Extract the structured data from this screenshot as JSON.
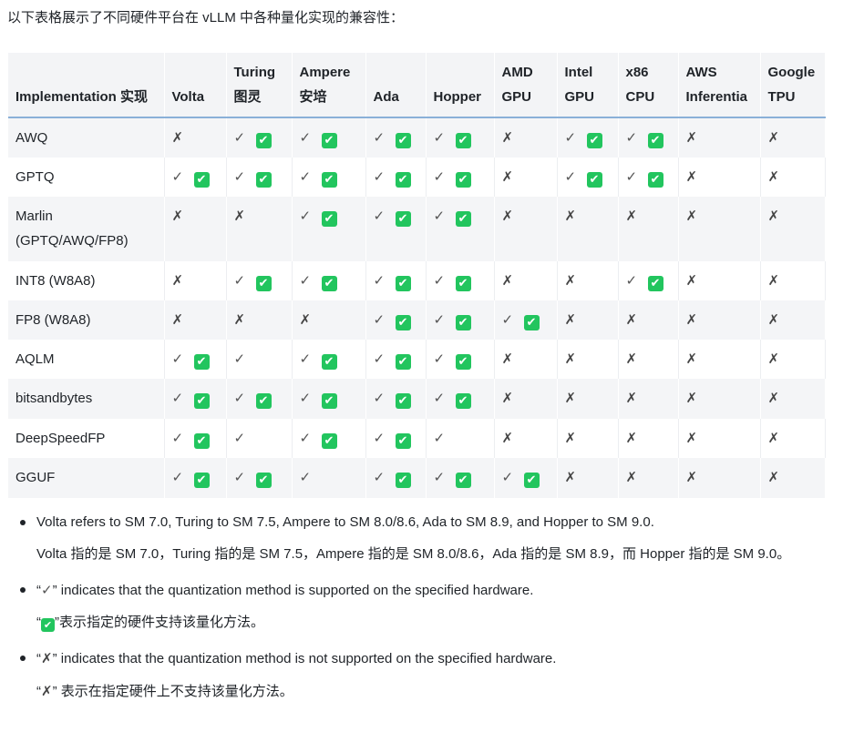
{
  "intro": "以下表格展示了不同硬件平台在 vLLM 中各种量化实现的兼容性：",
  "table": {
    "headers": [
      "Implementation 实现",
      "Volta",
      "Turing 图灵",
      "Ampere 安培",
      "Ada",
      "Hopper",
      "AMD GPU",
      "Intel GPU",
      "x86 CPU",
      "AWS Inferentia",
      "Google TPU"
    ],
    "rows": [
      {
        "name": "AWQ",
        "cells": [
          "x",
          "y",
          "y",
          "y",
          "y",
          "x",
          "y",
          "y",
          "x",
          "x"
        ]
      },
      {
        "name": "GPTQ",
        "cells": [
          "y",
          "y",
          "y",
          "y",
          "y",
          "x",
          "y",
          "y",
          "x",
          "x"
        ]
      },
      {
        "name": "Marlin (GPTQ/AWQ/FP8)",
        "cells": [
          "x",
          "x",
          "y",
          "y",
          "y",
          "x",
          "x",
          "x",
          "x",
          "x"
        ]
      },
      {
        "name": "INT8 (W8A8)",
        "cells": [
          "x",
          "y",
          "y",
          "y",
          "y",
          "x",
          "x",
          "y",
          "x",
          "x"
        ]
      },
      {
        "name": "FP8 (W8A8)",
        "cells": [
          "x",
          "x",
          "x",
          "y",
          "y",
          "y",
          "x",
          "x",
          "x",
          "x"
        ]
      },
      {
        "name": "AQLM",
        "cells": [
          "y",
          "c",
          "y",
          "y",
          "y",
          "x",
          "x",
          "x",
          "x",
          "x"
        ]
      },
      {
        "name": "bitsandbytes",
        "cells": [
          "y",
          "y",
          "y",
          "y",
          "y",
          "x",
          "x",
          "x",
          "x",
          "x"
        ]
      },
      {
        "name": "DeepSpeedFP",
        "cells": [
          "y",
          "c",
          "y",
          "y",
          "c",
          "x",
          "x",
          "x",
          "x",
          "x"
        ]
      },
      {
        "name": "GGUF",
        "cells": [
          "y",
          "y",
          "c",
          "y",
          "y",
          "y",
          "x",
          "x",
          "x",
          "x"
        ]
      }
    ]
  },
  "symbols": {
    "check": "✓",
    "box": "✔",
    "cross": "✗"
  },
  "notes": [
    {
      "en": "Volta refers to SM 7.0, Turing to SM 7.5, Ampere to SM 8.0/8.6, Ada to SM 8.9, and Hopper to SM 9.0.",
      "zh": "Volta 指的是 SM 7.0，Turing 指的是 SM 7.5，Ampere 指的是 SM 8.0/8.6，Ada 指的是 SM 8.9，而 Hopper 指的是 SM 9.0。"
    },
    {
      "en_prefix": "“",
      "en_suffix": "” indicates that the quantization method is supported on the specified hardware.",
      "zh_prefix": "“",
      "zh_suffix": "”表示指定的硬件支持该量化方法。"
    },
    {
      "en_prefix": "“",
      "en_suffix": "” indicates that the quantization method is not supported on the specified hardware.",
      "zh_prefix": "“",
      "zh_suffix": "” 表示在指定硬件上不支持该量化方法。"
    }
  ],
  "colors": {
    "box_green": "#22c55e",
    "header_border": "#8ab0d8",
    "stripe": "#f4f5f7"
  }
}
